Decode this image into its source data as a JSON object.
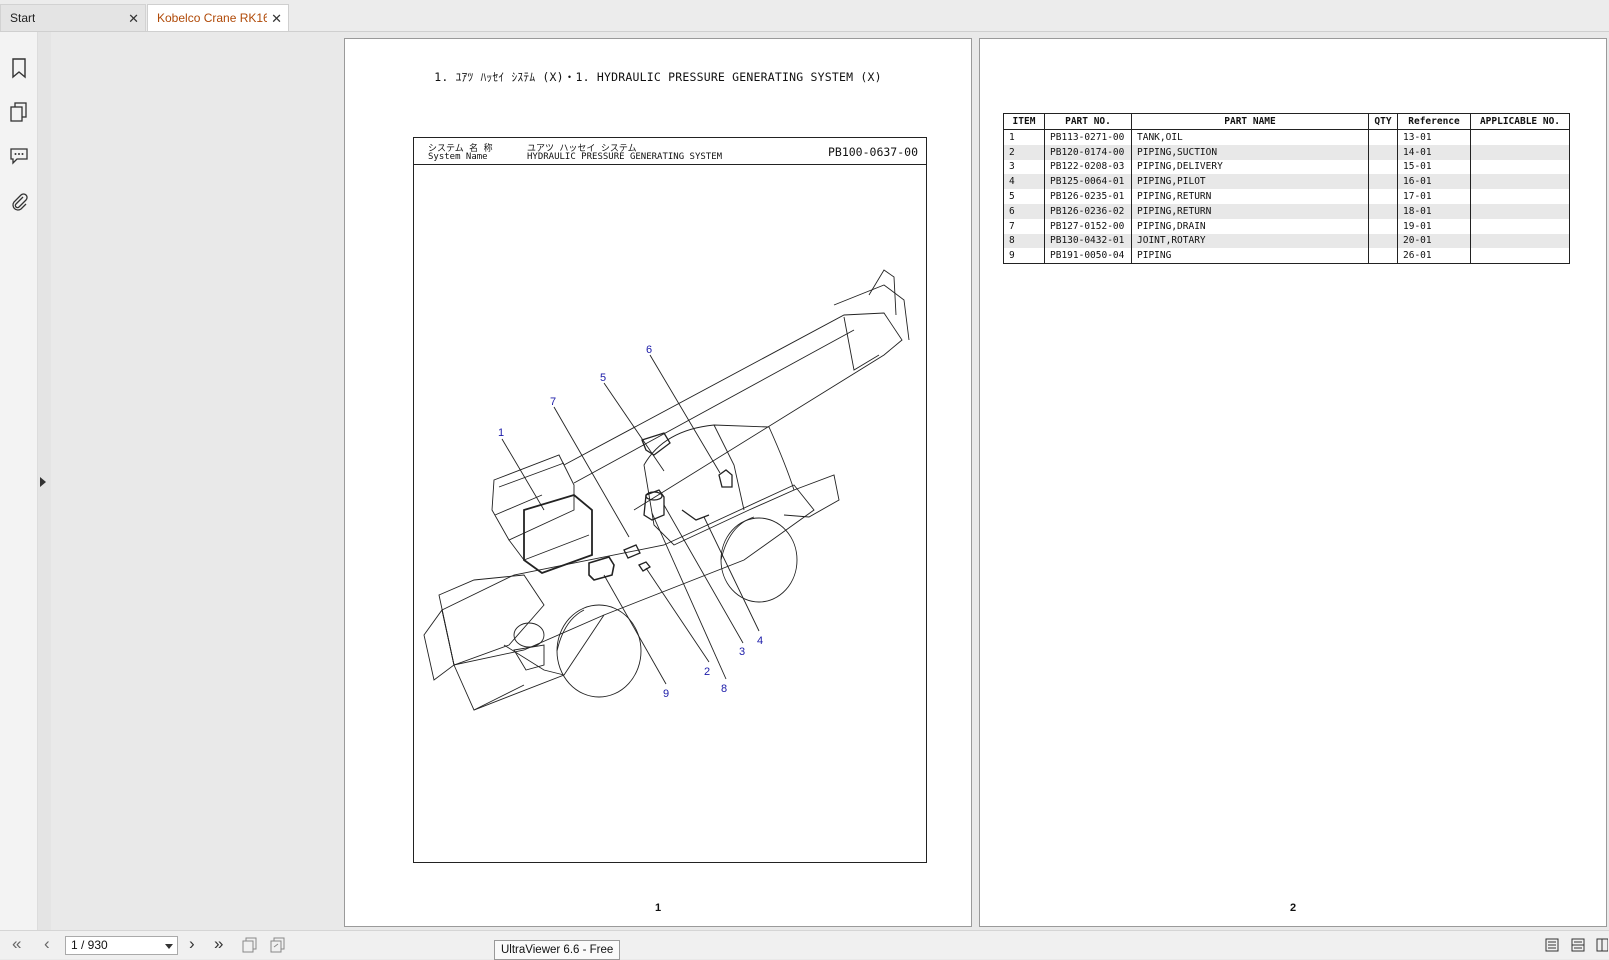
{
  "tabs": [
    {
      "label": "Start"
    },
    {
      "label": "Kobelco Crane RK16..."
    }
  ],
  "sidebar": {
    "icons": [
      "bookmark-icon",
      "pages-icon",
      "comments-icon",
      "attachment-icon"
    ]
  },
  "page1": {
    "title": "1. ﾕｱﾂ ﾊｯｾｲ ｼｽﾃﾑ (X)・1. HYDRAULIC PRESSURE GENERATING SYSTEM (X)",
    "system_label_jp": "システム 名 称",
    "system_label_en": "System   Name",
    "system_name_jp": "ユアツ ハッセイ システム",
    "system_name_en": "HYDRAULIC PRESSURE GENERATING SYSTEM",
    "drawing_no": "PB100-0637-00",
    "callouts": [
      "1",
      "2",
      "3",
      "4",
      "5",
      "6",
      "7",
      "8",
      "9"
    ],
    "page_number": "1"
  },
  "page2": {
    "columns": [
      "ITEM",
      "PART NO.",
      "PART NAME",
      "QTY",
      "Reference",
      "APPLICABLE NO."
    ],
    "rows": [
      {
        "item": "1",
        "part_no": "PB113-0271-00",
        "part_name": "TANK,OIL",
        "qty": "",
        "reference": "13-01",
        "applicable": ""
      },
      {
        "item": "2",
        "part_no": "PB120-0174-00",
        "part_name": "PIPING,SUCTION",
        "qty": "",
        "reference": "14-01",
        "applicable": ""
      },
      {
        "item": "3",
        "part_no": "PB122-0208-03",
        "part_name": "PIPING,DELIVERY",
        "qty": "",
        "reference": "15-01",
        "applicable": ""
      },
      {
        "item": "4",
        "part_no": "PB125-0064-01",
        "part_name": "PIPING,PILOT",
        "qty": "",
        "reference": "16-01",
        "applicable": ""
      },
      {
        "item": "5",
        "part_no": "PB126-0235-01",
        "part_name": "PIPING,RETURN",
        "qty": "",
        "reference": "17-01",
        "applicable": ""
      },
      {
        "item": "6",
        "part_no": "PB126-0236-02",
        "part_name": "PIPING,RETURN",
        "qty": "",
        "reference": "18-01",
        "applicable": ""
      },
      {
        "item": "7",
        "part_no": "PB127-0152-00",
        "part_name": "PIPING,DRAIN",
        "qty": "",
        "reference": "19-01",
        "applicable": ""
      },
      {
        "item": "8",
        "part_no": "PB130-0432-01",
        "part_name": "JOINT,ROTARY",
        "qty": "",
        "reference": "20-01",
        "applicable": ""
      },
      {
        "item": "9",
        "part_no": "PB191-0050-04",
        "part_name": "PIPING",
        "qty": "",
        "reference": "26-01",
        "applicable": ""
      }
    ],
    "page_number": "2"
  },
  "bottombar": {
    "page_indicator": "1 / 930",
    "status": "UltraViewer 6.6 - Free"
  },
  "colors": {
    "active_tab_text": "#b04a08",
    "callout_blue": "#1a1aa8"
  }
}
